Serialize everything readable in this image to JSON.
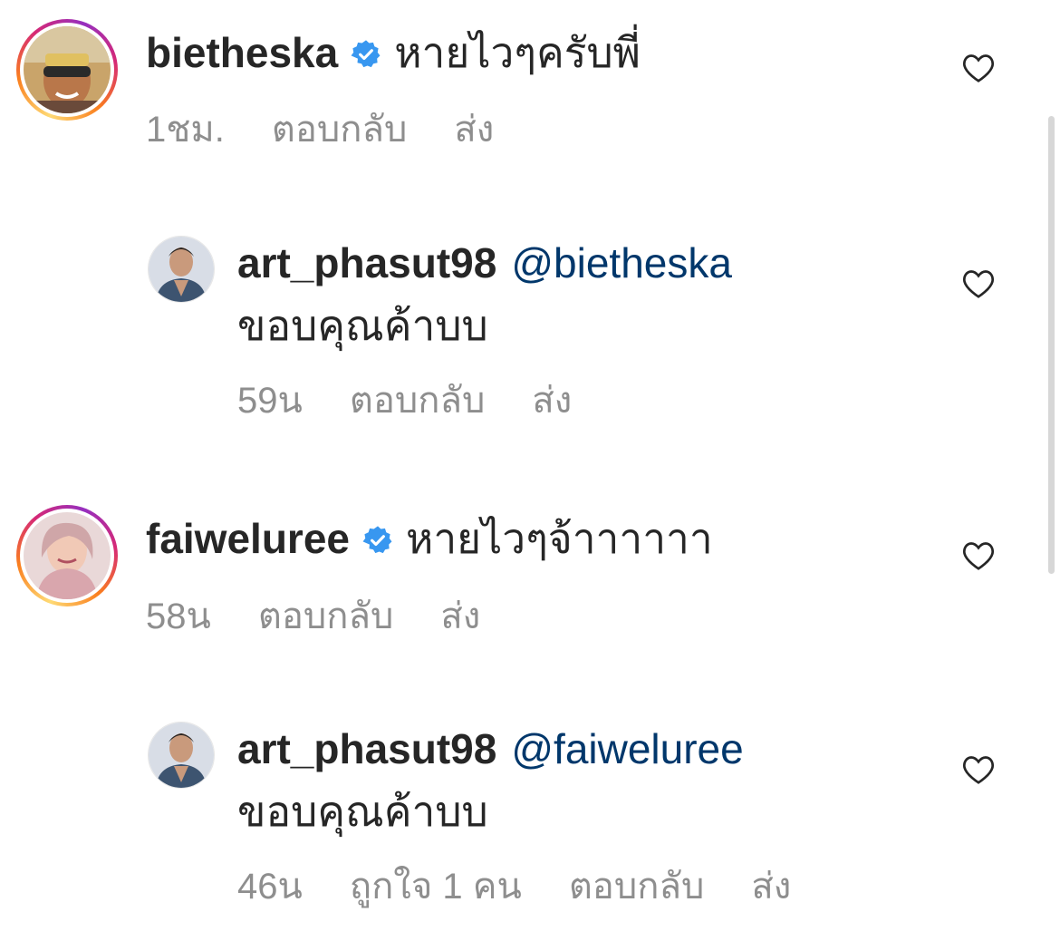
{
  "comments": [
    {
      "username": "bietheska",
      "verified": true,
      "text": "หายไวๆครับพี่",
      "time": "1ชม.",
      "reply_label": "ตอบกลับ",
      "send_label": "ส่ง"
    },
    {
      "username": "art_phasut98",
      "verified": false,
      "mention": "@bietheska",
      "text": "ขอบคุณค้าบบ",
      "time": "59น",
      "reply_label": "ตอบกลับ",
      "send_label": "ส่ง"
    },
    {
      "username": "faiweluree",
      "verified": true,
      "text": "หายไวๆจ้าาาาาา",
      "time": "58น",
      "reply_label": "ตอบกลับ",
      "send_label": "ส่ง"
    },
    {
      "username": "art_phasut98",
      "verified": false,
      "mention": "@faiweluree",
      "text": "ขอบคุณค้าบบ",
      "time": "46น",
      "likes": "ถูกใจ 1 คน",
      "reply_label": "ตอบกลับ",
      "send_label": "ส่ง"
    }
  ],
  "icons": {
    "verified": "verified-badge-icon",
    "like": "heart-outline-icon"
  },
  "colors": {
    "text": "#262626",
    "secondary": "#8e8e8e",
    "mention": "#00376b",
    "verified": "#3897f0"
  }
}
